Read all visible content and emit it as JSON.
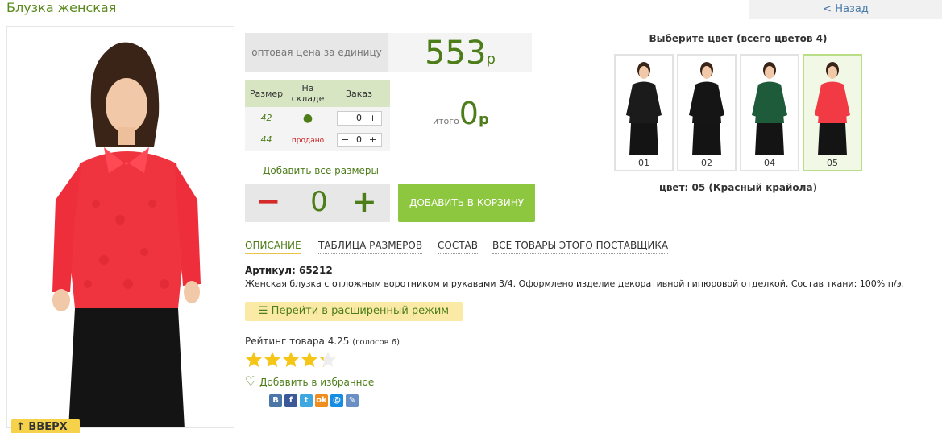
{
  "title": "Блузка женская",
  "back_label": "< Назад",
  "up_label": "↑ ВВЕРХ",
  "price": {
    "label": "оптовая цена за единицу",
    "value": "553",
    "currency": "р"
  },
  "sizes_table": {
    "headers": [
      "Размер",
      "На складе",
      "Заказ"
    ],
    "rows": [
      {
        "size": "42",
        "stock": "●",
        "qty": "0"
      },
      {
        "size": "44",
        "stock": "продано",
        "qty": "0"
      }
    ],
    "minus": "−",
    "plus": "+"
  },
  "total": {
    "label": "итого",
    "value": "0",
    "currency": "р"
  },
  "add_all_sizes": "Добавить все размеры",
  "big_stepper": {
    "minus": "−",
    "value": "0",
    "plus": "+"
  },
  "add_to_cart": "ДОБАВИТЬ В КОРЗИНУ",
  "colors": {
    "heading": "Выберите цвет (всего цветов 4)",
    "swatches": [
      {
        "label": "01",
        "color": "#1b1b1b"
      },
      {
        "label": "02",
        "color": "#151515"
      },
      {
        "label": "04",
        "color": "#1e5b3a"
      },
      {
        "label": "05",
        "color": "#f23a45"
      }
    ],
    "selected": "цвет: 05 (Красный крайола)"
  },
  "tabs": [
    "ОПИСАНИЕ",
    "ТАБЛИЦА РАЗМЕРОВ",
    "СОСТАВ",
    "ВСЕ ТОВАРЫ ЭТОГО ПОСТАВЩИКА"
  ],
  "article": "Артикул: 65212",
  "description": "Женская блузка с отложным воротником и рукавами 3/4. Оформлено изделие декоративной гипюровой отделкой. Состав ткани: 100% п/э.",
  "advanced_mode": "Перейти в расширенный режим",
  "rating": {
    "text": "Рейтинг товара 4.25",
    "votes": "(голосов 6)",
    "value": 4.25,
    "max": 5
  },
  "favorite": "Добавить в избранное",
  "social": [
    {
      "icon": "vk-icon",
      "glyph": "В",
      "color": "#4a76a8"
    },
    {
      "icon": "facebook-icon",
      "glyph": "f",
      "color": "#3b5998"
    },
    {
      "icon": "twitter-icon",
      "glyph": "t",
      "color": "#3fa7e0"
    },
    {
      "icon": "odnoklassniki-icon",
      "glyph": "ok",
      "color": "#ef8d1e"
    },
    {
      "icon": "mailru-icon",
      "glyph": "@",
      "color": "#168de2"
    },
    {
      "icon": "livejournal-icon",
      "glyph": "✎",
      "color": "#6a8fc4"
    }
  ]
}
